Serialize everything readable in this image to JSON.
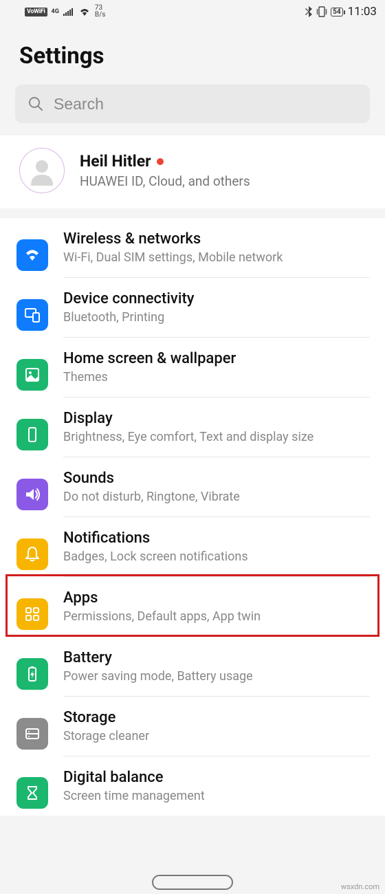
{
  "status": {
    "vowifi": "VoWiFi",
    "net": "4G",
    "speed_num": "73",
    "speed_unit": "B/s",
    "battery": "54",
    "time": "11:03"
  },
  "page_title": "Settings",
  "search": {
    "placeholder": "Search"
  },
  "account": {
    "name": "Heil Hitler",
    "subtitle": "HUAWEI ID, Cloud, and others"
  },
  "items": [
    {
      "icon": "wifi",
      "color": "ic-blue",
      "title": "Wireless & networks",
      "sub": "Wi-Fi, Dual SIM settings, Mobile network"
    },
    {
      "icon": "devconn",
      "color": "ic-blue",
      "title": "Device connectivity",
      "sub": "Bluetooth, Printing"
    },
    {
      "icon": "wallpaper",
      "color": "ic-green",
      "title": "Home screen & wallpaper",
      "sub": "Themes"
    },
    {
      "icon": "display",
      "color": "ic-green",
      "title": "Display",
      "sub": "Brightness, Eye comfort, Text and display size"
    },
    {
      "icon": "sounds",
      "color": "ic-purple",
      "title": "Sounds",
      "sub": "Do not disturb, Ringtone, Vibrate"
    },
    {
      "icon": "bell",
      "color": "ic-amber",
      "title": "Notifications",
      "sub": "Badges, Lock screen notifications"
    },
    {
      "icon": "apps",
      "color": "ic-amber",
      "title": "Apps",
      "sub": "Permissions, Default apps, App twin"
    },
    {
      "icon": "battery",
      "color": "ic-green",
      "title": "Battery",
      "sub": "Power saving mode, Battery usage"
    },
    {
      "icon": "storage",
      "color": "ic-grey",
      "title": "Storage",
      "sub": "Storage cleaner"
    },
    {
      "icon": "hourglass",
      "color": "ic-green",
      "title": "Digital balance",
      "sub": "Screen time management"
    }
  ],
  "highlight_index": 6,
  "watermark": "wsxdn.com"
}
